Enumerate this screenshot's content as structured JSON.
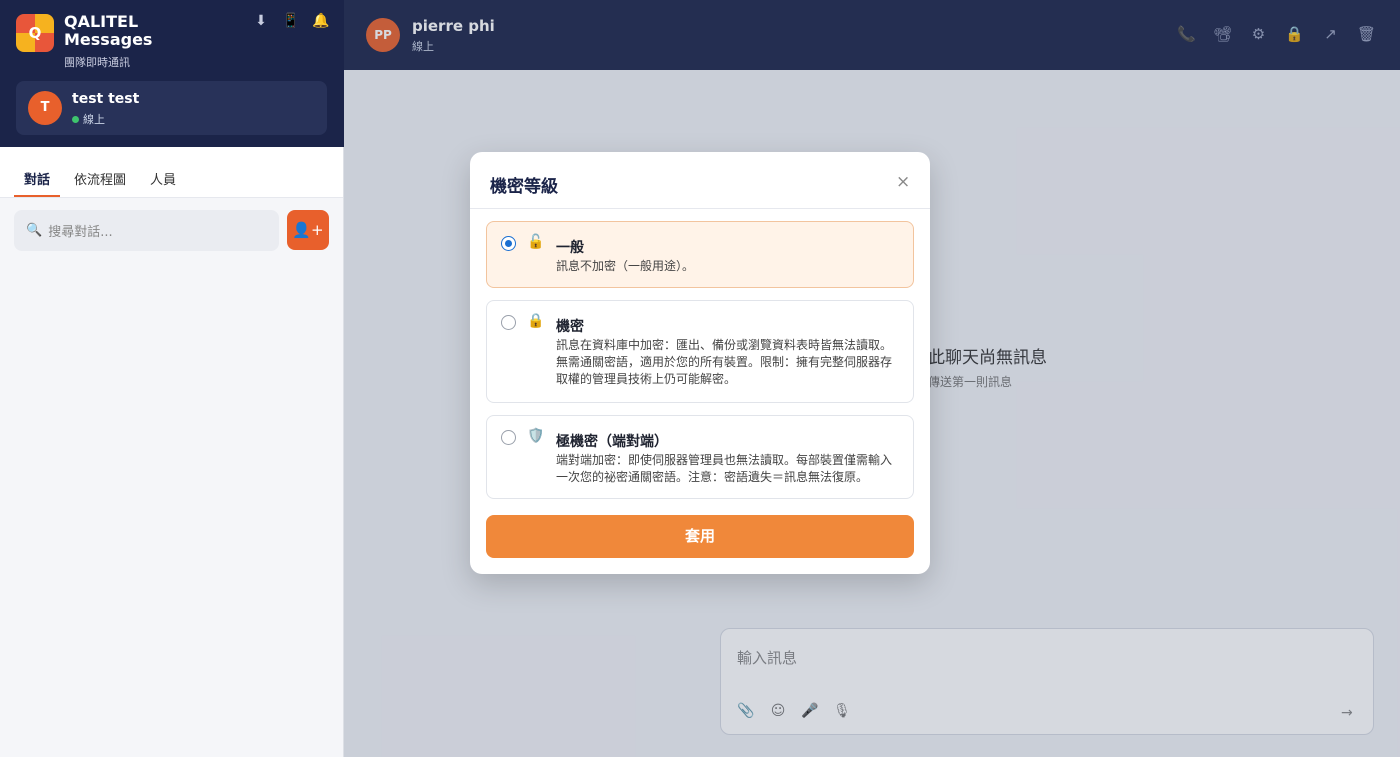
{
  "app": {
    "name": "QALITEL Messages",
    "logo_letter": "Q",
    "subtitle": "團隊即時通訊",
    "header_icons": [
      "download-icon",
      "phone-device-icon",
      "bell-icon"
    ]
  },
  "current_user": {
    "initial": "T",
    "name": "test test",
    "status": "線上"
  },
  "tabs": [
    {
      "label": "對話",
      "active": true
    },
    {
      "label": "依流程圖",
      "active": false
    },
    {
      "label": "人員",
      "active": false
    }
  ],
  "search": {
    "placeholder": "搜尋對話..."
  },
  "add_button": {
    "label": "👤+"
  },
  "chat_header": {
    "initials": "PP",
    "name": "pierre phi",
    "status": "線上",
    "icons": [
      "phone-icon",
      "video-icon",
      "gear-icon",
      "lock-icon",
      "share-icon",
      "trash-icon"
    ]
  },
  "empty_state": {
    "title": "此聊天尚無訊息",
    "subtitle": "傳送第一則訊息"
  },
  "composer": {
    "placeholder": "輸入訊息",
    "tools": [
      "attach-icon",
      "emoji-icon",
      "mic-icon",
      "voice-icon"
    ],
    "send": "→"
  },
  "modal": {
    "title": "機密等級",
    "close": "×",
    "options": [
      {
        "icon": "🔓",
        "title": "一般",
        "description": "訊息不加密（一般用途）。",
        "selected": true
      },
      {
        "icon": "🔒",
        "title": "機密",
        "description": "訊息在資料庫中加密：匯出、備份或瀏覽資料表時皆無法讀取。無需通關密語，適用於您的所有裝置。限制：擁有完整伺服器存取權的管理員技術上仍可能解密。",
        "selected": false
      },
      {
        "icon": "🛡️",
        "title": "極機密（端對端）",
        "description": "端對端加密：即使伺服器管理員也無法讀取。每部裝置僅需輸入一次您的祕密通關密語。注意：密語遺失＝訊息無法復原。",
        "selected": false
      }
    ],
    "apply_label": "套用"
  },
  "colors": {
    "navy": "#1b2449",
    "accent": "#e8602c",
    "apply": "#f0883a",
    "online": "#3ec46d",
    "radio": "#1a6fd1"
  }
}
